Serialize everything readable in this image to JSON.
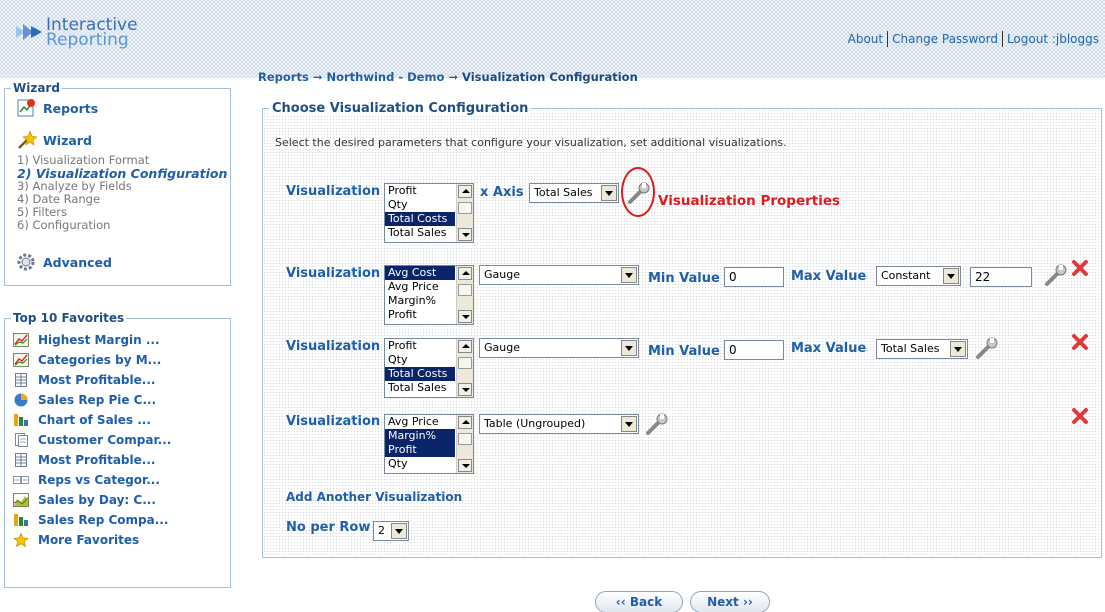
{
  "header": {
    "logo_line1": "Interactive",
    "logo_line2": "Reporting",
    "links": {
      "about": "About",
      "change_password": "Change Password",
      "logout": "Logout :jbloggs"
    }
  },
  "sidebar": {
    "wizard_title": "Wizard",
    "reports_label": "Reports",
    "wizard_label": "Wizard",
    "steps": [
      "1) Visualization Format",
      "2) Visualization Configuration",
      "3) Analyze by Fields",
      "4) Date Range",
      "5) Filters",
      "6) Configuration"
    ],
    "advanced_label": "Advanced",
    "favorites_title": "Top 10 Favorites",
    "favorites": [
      {
        "label": "Highest Margin ...",
        "icon": "line-chart-icon"
      },
      {
        "label": "Categories by M...",
        "icon": "line-chart-icon"
      },
      {
        "label": "Most Profitable...",
        "icon": "table-icon"
      },
      {
        "label": "Sales Rep Pie C...",
        "icon": "pie-chart-icon"
      },
      {
        "label": "Chart of Sales ...",
        "icon": "bar-chart-icon"
      },
      {
        "label": "Customer Compar...",
        "icon": "document-icon"
      },
      {
        "label": "Most Profitable...",
        "icon": "table-icon"
      },
      {
        "label": "Reps vs Categor...",
        "icon": "grid-icon"
      },
      {
        "label": "Sales by Day: C...",
        "icon": "area-chart-icon"
      },
      {
        "label": "Sales Rep Compa...",
        "icon": "bar-chart-icon"
      }
    ],
    "more_favorites": "More Favorites"
  },
  "breadcrumb": {
    "reports": "Reports",
    "project": "Northwind - Demo",
    "current": "Visualization Configuration",
    "arrow": "➞"
  },
  "main": {
    "title": "Choose Visualization Configuration",
    "intro": "Select the desired parameters that configure your visualization, set additional visualizations.",
    "visualization_label": "Visualization",
    "x_axis_label": "x Axis",
    "min_value_label": "Min Value",
    "max_value_label": "Max Value",
    "properties_label": "Visualization Properties",
    "rows": [
      {
        "fields": [
          "Profit",
          "Qty",
          "Total Costs",
          "Total Sales"
        ],
        "selected": [
          2
        ],
        "x_axis": "Total Sales"
      },
      {
        "fields": [
          "Avg Cost",
          "Avg Price",
          "Margin%",
          "Profit"
        ],
        "selected": [
          0
        ],
        "type": "Gauge",
        "min": "0",
        "max_mode": "Constant",
        "max": "22"
      },
      {
        "fields": [
          "Profit",
          "Qty",
          "Total Costs",
          "Total Sales"
        ],
        "selected": [
          2
        ],
        "type": "Gauge",
        "min": "0",
        "max_mode": "Total Sales"
      },
      {
        "fields": [
          "Avg Price",
          "Margin%",
          "Profit",
          "Qty"
        ],
        "selected": [
          1,
          2
        ],
        "type": "Table (Ungrouped)"
      }
    ],
    "add_visualization": "Add Another Visualization",
    "per_row_label": "No per Row",
    "per_row_value": "2"
  },
  "nav": {
    "back": "‹‹ Back",
    "next": "Next ››"
  },
  "colors": {
    "link_blue": "#1f5ea8",
    "highlight_red": "#e0191e",
    "selection": "#0a246a"
  }
}
